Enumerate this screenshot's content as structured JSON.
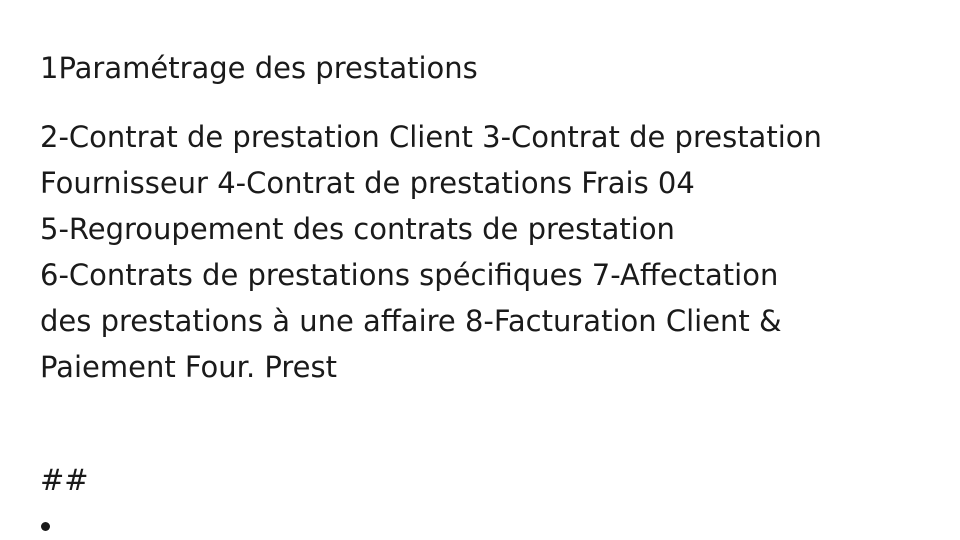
{
  "document": {
    "heading": "1Paramétrage des prestations",
    "body_lines": [
      "2-Contrat de prestation Client 3-Contrat de prestation",
      "Fournisseur 4-Contrat de prestations Frais 04",
      "5-Regroupement des contrats de prestation",
      "6-Contrats de prestations spécifiques 7-Affectation",
      "des prestations à une affaire 8-Facturation Client &",
      "Paiement Four. Prest"
    ],
    "hash_marker": "##"
  }
}
